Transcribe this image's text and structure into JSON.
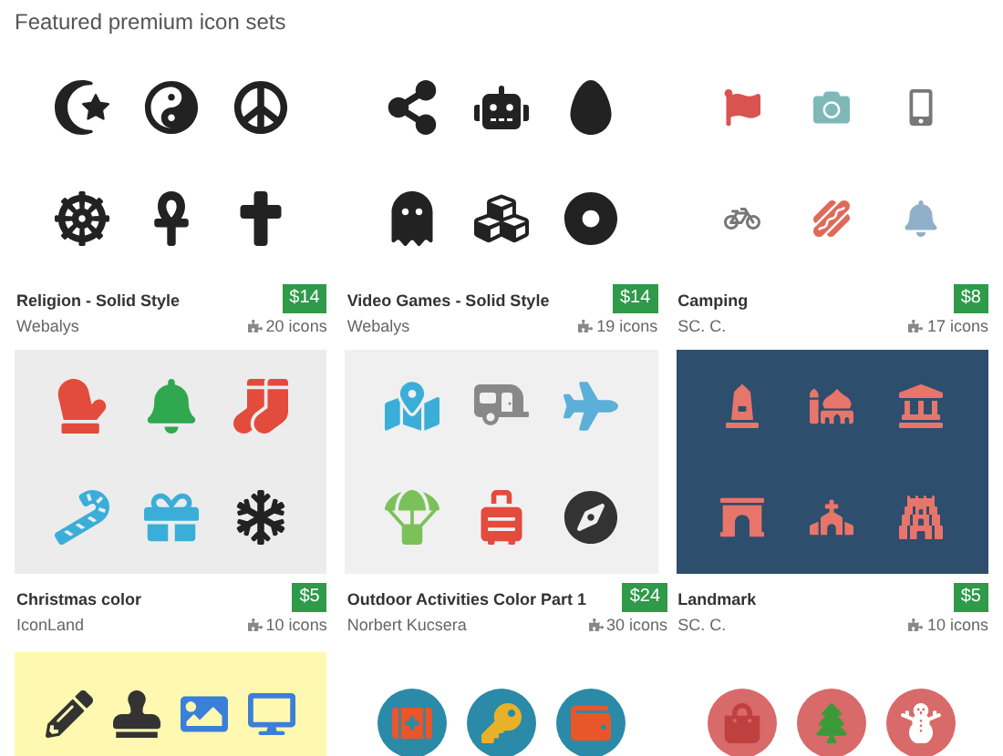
{
  "heading": "Featured premium icon sets",
  "sets": [
    {
      "title": "Religion - Solid Style",
      "author": "Webalys",
      "price": "$14",
      "count": "20 icons"
    },
    {
      "title": "Video Games - Solid Style",
      "author": "Webalys",
      "price": "$14",
      "count": "19 icons"
    },
    {
      "title": "Camping",
      "author": "SC. C.",
      "price": "$8",
      "count": "17 icons"
    },
    {
      "title": "Christmas color",
      "author": "IconLand",
      "price": "$5",
      "count": "10 icons"
    },
    {
      "title": "Outdoor Activities Color Part 1",
      "author": "Norbert Kucsera",
      "price": "$24",
      "count": "30 icons"
    },
    {
      "title": "Landmark",
      "author": "SC. C.",
      "price": "$5",
      "count": "10 icons"
    }
  ]
}
